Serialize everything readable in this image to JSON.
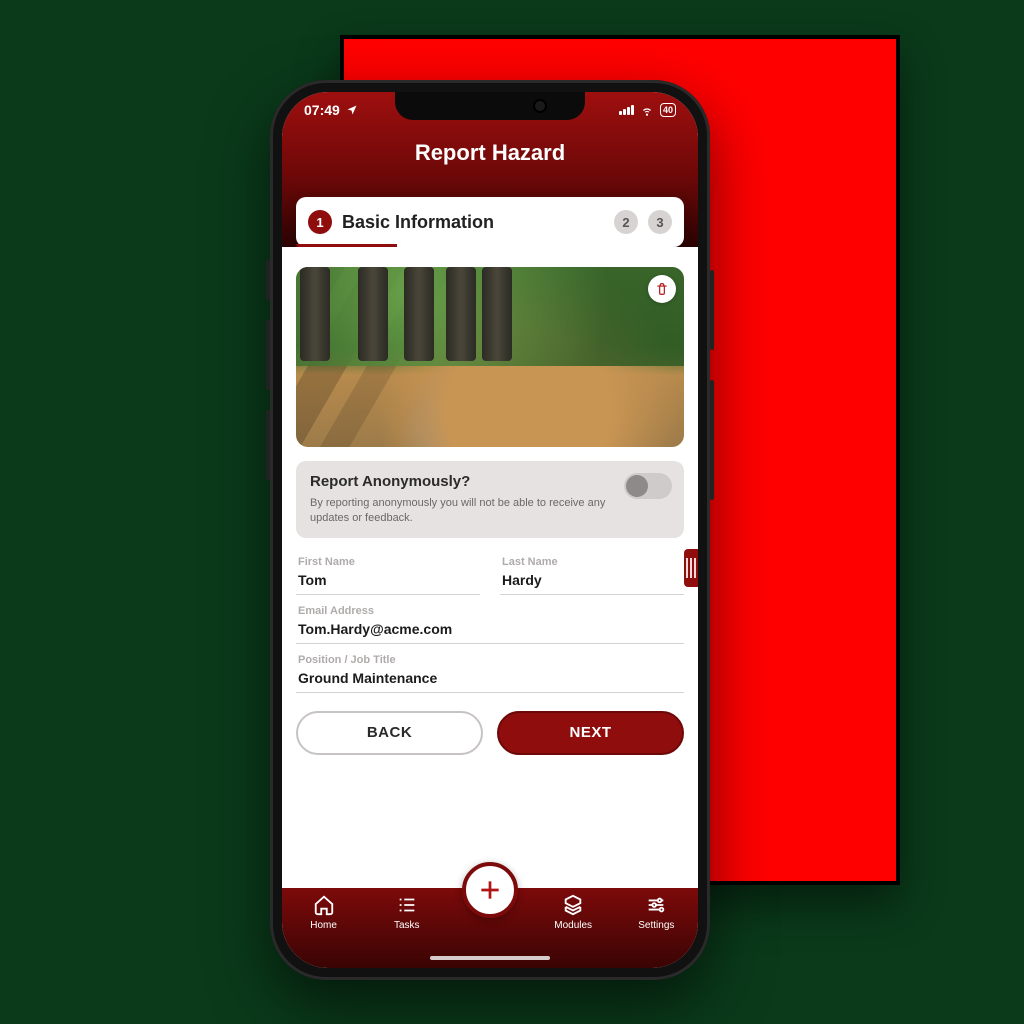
{
  "status": {
    "time": "07:49",
    "battery": "40"
  },
  "header": {
    "title": "Report Hazard"
  },
  "steps": {
    "current": "1",
    "currentLabel": "Basic Information",
    "next1": "2",
    "next2": "3"
  },
  "anonymous": {
    "title": "Report Anonymously?",
    "subtitle": "By reporting anonymously you will not be able to receive any updates or feedback.",
    "enabled": false
  },
  "form": {
    "firstName": {
      "label": "First Name",
      "value": "Tom"
    },
    "lastName": {
      "label": "Last Name",
      "value": "Hardy"
    },
    "email": {
      "label": "Email Address",
      "value": "Tom.Hardy@acme.com"
    },
    "position": {
      "label": "Position / Job Title",
      "value": "Ground Maintenance"
    }
  },
  "buttons": {
    "back": "BACK",
    "next": "NEXT"
  },
  "nav": {
    "home": "Home",
    "tasks": "Tasks",
    "modules": "Modules",
    "settings": "Settings"
  }
}
